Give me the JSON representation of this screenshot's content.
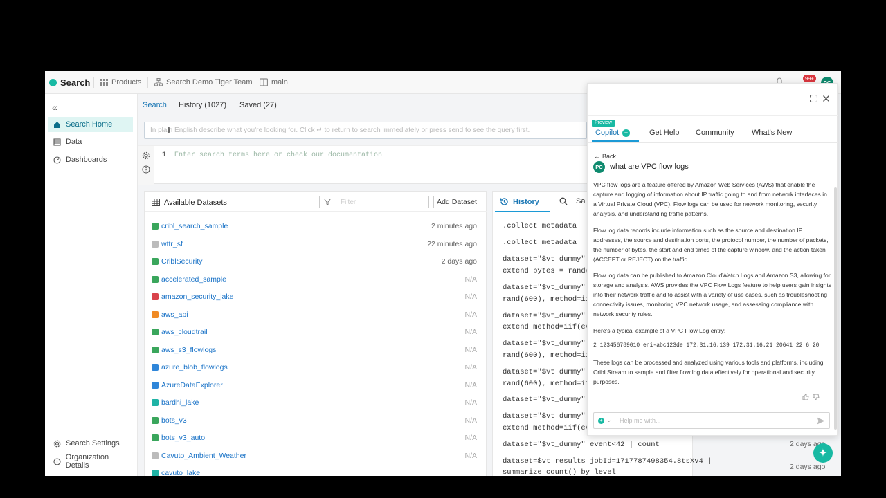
{
  "topbar": {
    "brand": "Search",
    "products": "Products",
    "workspace": "Search Demo Tiger Team",
    "branch": "main",
    "notif_count": "99+",
    "avatar": "PC"
  },
  "sidebar": {
    "items": [
      {
        "label": "Search Home",
        "icon": "home-icon"
      },
      {
        "label": "Data",
        "icon": "data-icon"
      },
      {
        "label": "Dashboards",
        "icon": "dashboard-icon"
      }
    ],
    "bottom": [
      {
        "label": "Search Settings",
        "icon": "gear-icon"
      },
      {
        "label": "Organization Details",
        "icon": "info-icon"
      }
    ]
  },
  "subtabs": {
    "search": "Search",
    "history": "History (1027)",
    "saved": "Saved (27)"
  },
  "query": {
    "placeholder": "In plain English describe what you're looking for. Click ↵ to return to search immediately or press send to see the query first."
  },
  "editor": {
    "line": "1",
    "placeholder": "Enter search terms here or check our documentation"
  },
  "datasets": {
    "title": "Available Datasets",
    "filter_placeholder": "Filter",
    "add_button": "Add Dataset",
    "rows": [
      {
        "name": "cribl_search_sample",
        "time": "2 minutes ago",
        "color": "#3aa65c"
      },
      {
        "name": "wttr_sf",
        "time": "22 minutes ago",
        "color": "#bbbbbb"
      },
      {
        "name": "CriblSecurity",
        "time": "2 days ago",
        "color": "#3aa65c"
      },
      {
        "name": "accelerated_sample",
        "time": "N/A",
        "color": "#3aa65c"
      },
      {
        "name": "amazon_security_lake",
        "time": "N/A",
        "color": "#d9434b"
      },
      {
        "name": "aws_api",
        "time": "N/A",
        "color": "#f08a24"
      },
      {
        "name": "aws_cloudtrail",
        "time": "N/A",
        "color": "#3aa65c"
      },
      {
        "name": "aws_s3_flowlogs",
        "time": "N/A",
        "color": "#3aa65c"
      },
      {
        "name": "azure_blob_flowlogs",
        "time": "N/A",
        "color": "#2f86d9"
      },
      {
        "name": "AzureDataExplorer",
        "time": "N/A",
        "color": "#2f86d9"
      },
      {
        "name": "bardhi_lake",
        "time": "N/A",
        "color": "#1fb3a5"
      },
      {
        "name": "bots_v3",
        "time": "N/A",
        "color": "#3aa65c"
      },
      {
        "name": "bots_v3_auto",
        "time": "N/A",
        "color": "#3aa65c"
      },
      {
        "name": "Cavuto_Ambient_Weather",
        "time": "N/A",
        "color": "#bbbbbb"
      },
      {
        "name": "cavuto_lake",
        "time": "",
        "color": "#1fb3a5"
      }
    ]
  },
  "history": {
    "tab": "History",
    "tab2": "Sa",
    "lines": [
      ".collect metadata",
      ".collect metadata",
      "dataset=\"$vt_dummy\" e",
      " extend bytes = rand(",
      "dataset=\"$vt_dummy\" e",
      "rand(600), method=iif",
      "dataset=\"$vt_dummy\" e",
      " extend method=iif(ev",
      "dataset=\"$vt_dummy\" e",
      "rand(600), method=iif",
      "dataset=\"$vt_dummy\" e",
      "rand(600), method=iif",
      "dataset=\"$vt_dummy\" e",
      "dataset=\"$vt_dummy\" e",
      " extend method=iif(ev",
      "dataset=\"$vt_dummy\" event<42 | count",
      "dataset=$vt_results jobId=1717787498354.8tsXv4 |",
      " summarize count() by level"
    ],
    "times": [
      "2 days ago",
      "2 days ago"
    ]
  },
  "copilot": {
    "preview": "Preview",
    "tabs": [
      "Copilot",
      "Get Help",
      "Community",
      "What's New"
    ],
    "back": "Back",
    "question": "what are VPC flow logs",
    "avatar": "PC",
    "paragraphs": [
      "VPC flow logs are a feature offered by Amazon Web Services (AWS) that enable the capture and logging of information about IP traffic going to and from network interfaces in a Virtual Private Cloud (VPC). Flow logs can be used for network monitoring, security analysis, and understanding traffic patterns.",
      "Flow log data records include information such as the source and destination IP addresses, the source and destination ports, the protocol number, the number of packets, the number of bytes, the start and end times of the capture window, and the action taken (ACCEPT or REJECT) on the traffic.",
      "Flow log data can be published to Amazon CloudWatch Logs and Amazon S3, allowing for storage and analysis. AWS provides the VPC Flow Logs feature to help users gain insights into their network traffic and to assist with a variety of use cases, such as troubleshooting connectivity issues, monitoring VPC network usage, and assessing compliance with network security rules.",
      "Here's a typical example of a VPC Flow Log entry:",
      "2 123456789010 eni-abc123de 172.31.16.139 172.31.16.21 20641 22 6 20",
      "These logs can be processed and analyzed using various tools and platforms, including Cribl Stream to sample and filter flow log data effectively for operational and security purposes."
    ],
    "input_placeholder": "Help me with..."
  },
  "colors": {
    "accent": "#1c9ad6",
    "teal": "#18b9a3",
    "link": "#1a73c7"
  }
}
